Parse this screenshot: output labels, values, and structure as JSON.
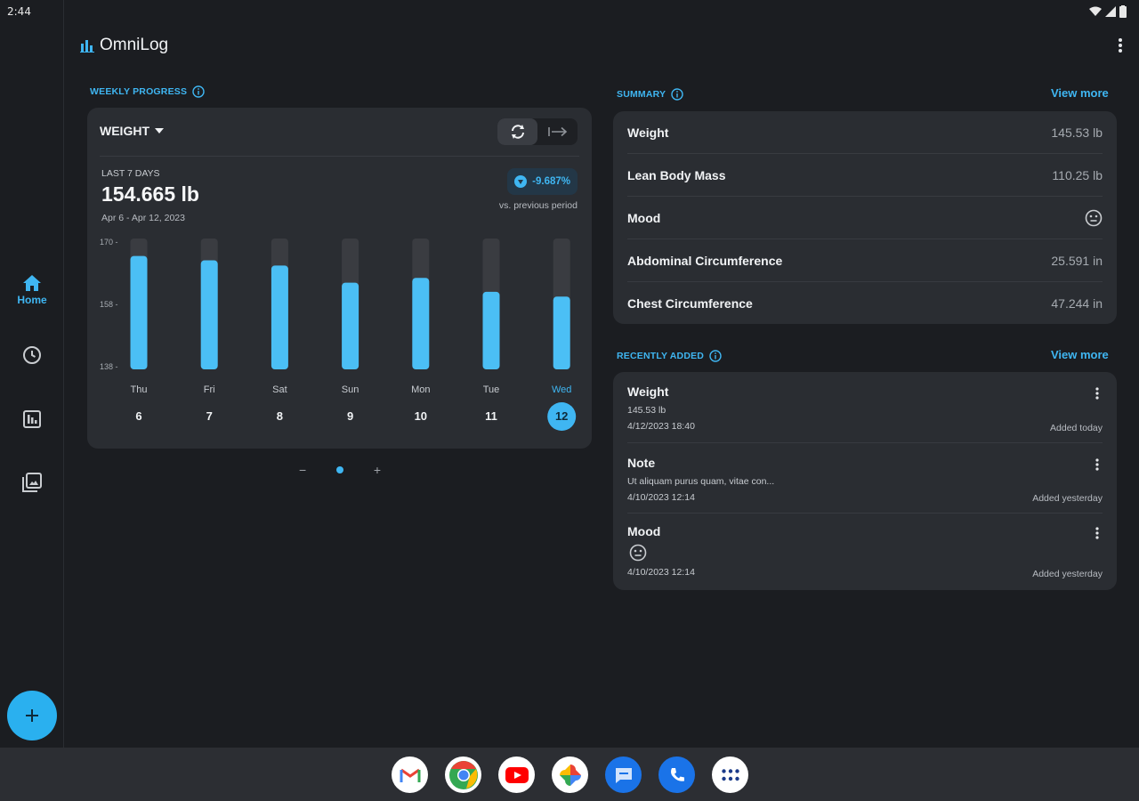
{
  "status": {
    "time": "2:44"
  },
  "app": {
    "title": "OmniLog"
  },
  "rail": {
    "home_label": "Home"
  },
  "weekly": {
    "section_title": "WEEKLY PROGRESS",
    "metric": "WEIGHT",
    "range_label": "LAST 7 DAYS",
    "value": "154.665 lb",
    "date_range": "Apr 6 - Apr 12, 2023",
    "delta": "-9.687%",
    "delta_caption": "vs. previous period"
  },
  "summary": {
    "section_title": "SUMMARY",
    "view_more": "View more",
    "rows": [
      {
        "label": "Weight",
        "value": "145.53 lb"
      },
      {
        "label": "Lean Body Mass",
        "value": "110.25 lb"
      },
      {
        "label": "Mood",
        "value": "",
        "icon": "neutral-face-icon"
      },
      {
        "label": "Abdominal Circumference",
        "value": "25.591 in"
      },
      {
        "label": "Chest Circumference",
        "value": "47.244 in"
      }
    ]
  },
  "recent": {
    "section_title": "RECENTLY ADDED",
    "view_more": "View more",
    "items": [
      {
        "title": "Weight",
        "detail": "145.53 lb",
        "date": "4/12/2023 18:40",
        "added": "Added today"
      },
      {
        "title": "Note",
        "detail": "Ut aliquam purus quam, vitae con...",
        "date": "4/10/2023 12:14",
        "added": "Added yesterday"
      },
      {
        "title": "Mood",
        "detail": "",
        "icon": "neutral-face-icon",
        "date": "4/10/2023 12:14",
        "added": "Added yesterday"
      }
    ]
  },
  "colors": {
    "accent": "#3fb6f2",
    "bar": "#4bbff5",
    "track": "#3a3c41",
    "card": "#2a2d32",
    "background": "#1b1d21"
  },
  "chart_data": {
    "type": "bar",
    "categories": [
      "Thu",
      "Fri",
      "Sat",
      "Sun",
      "Mon",
      "Tue",
      "Wed"
    ],
    "day_numbers": [
      "6",
      "7",
      "8",
      "9",
      "10",
      "11",
      "12"
    ],
    "selected_index": 6,
    "values": [
      166.5,
      165.4,
      164.1,
      159.8,
      161.0,
      157.5,
      156.3
    ],
    "yticks": [
      "170",
      "158",
      "138"
    ],
    "ylim": [
      138,
      170
    ]
  },
  "dock": [
    "gmail-icon",
    "chrome-icon",
    "youtube-icon",
    "photos-icon",
    "messages-icon",
    "phone-icon",
    "apps-icon"
  ]
}
